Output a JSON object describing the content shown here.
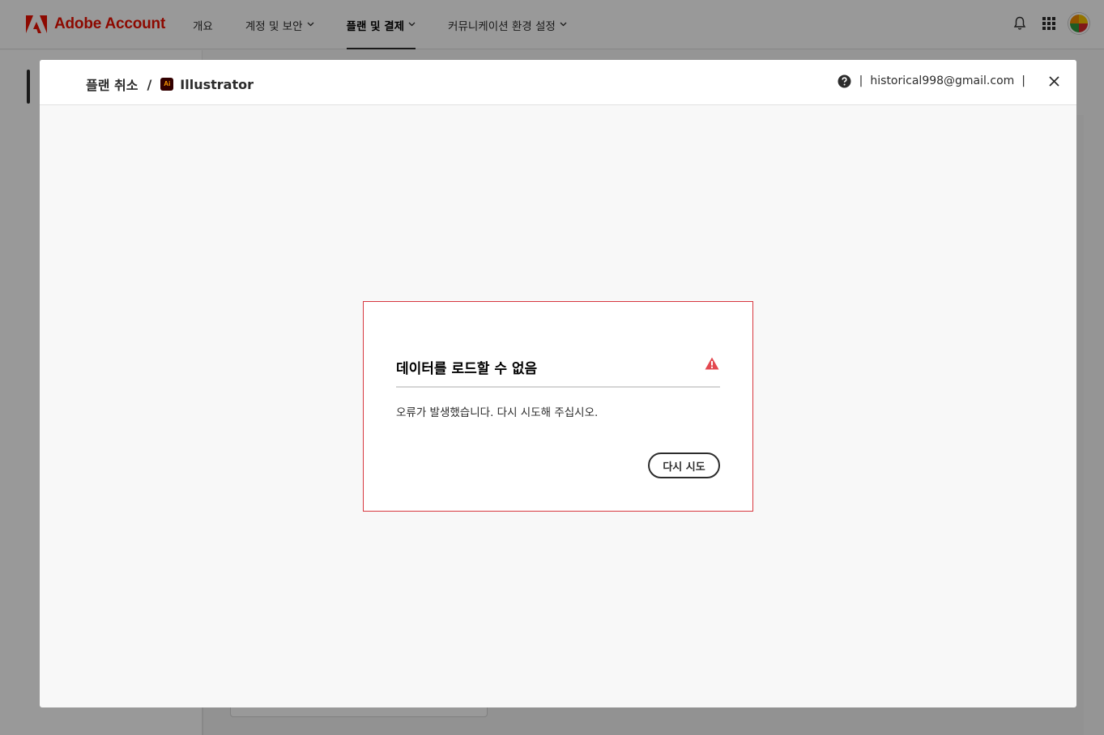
{
  "topnav": {
    "brand_name": "Adobe Account",
    "items": [
      {
        "label": "개요",
        "has_dropdown": false,
        "active": false
      },
      {
        "label": "계정 및 보안",
        "has_dropdown": true,
        "active": false
      },
      {
        "label": "플랜 및 결제",
        "has_dropdown": true,
        "active": true
      },
      {
        "label": "커뮤니케이션 환경 설정",
        "has_dropdown": true,
        "active": false
      }
    ],
    "icons": [
      "bell-icon",
      "apps-grid-icon",
      "avatar"
    ]
  },
  "modal": {
    "breadcrumb": {
      "parent": "플랜 취소",
      "separator": "/",
      "app_icon": "illustrator-app-icon",
      "app_icon_text": "Ai",
      "current": "Illustrator"
    },
    "help_icon": "help-icon",
    "email": "historical998@gmail.com",
    "pipe": "|",
    "close_icon": "close-icon"
  },
  "error": {
    "title": "데이터를 로드할 수 없음",
    "icon": "warning-icon",
    "message": "오류가 발생했습니다. 다시 시도해 주십시오.",
    "retry_label": "다시 시도"
  },
  "colors": {
    "brand_red": "#eb1000",
    "error_border": "#d7373f",
    "warning_red": "#e34850",
    "overlay": "rgba(0,0,0,0.40)"
  }
}
